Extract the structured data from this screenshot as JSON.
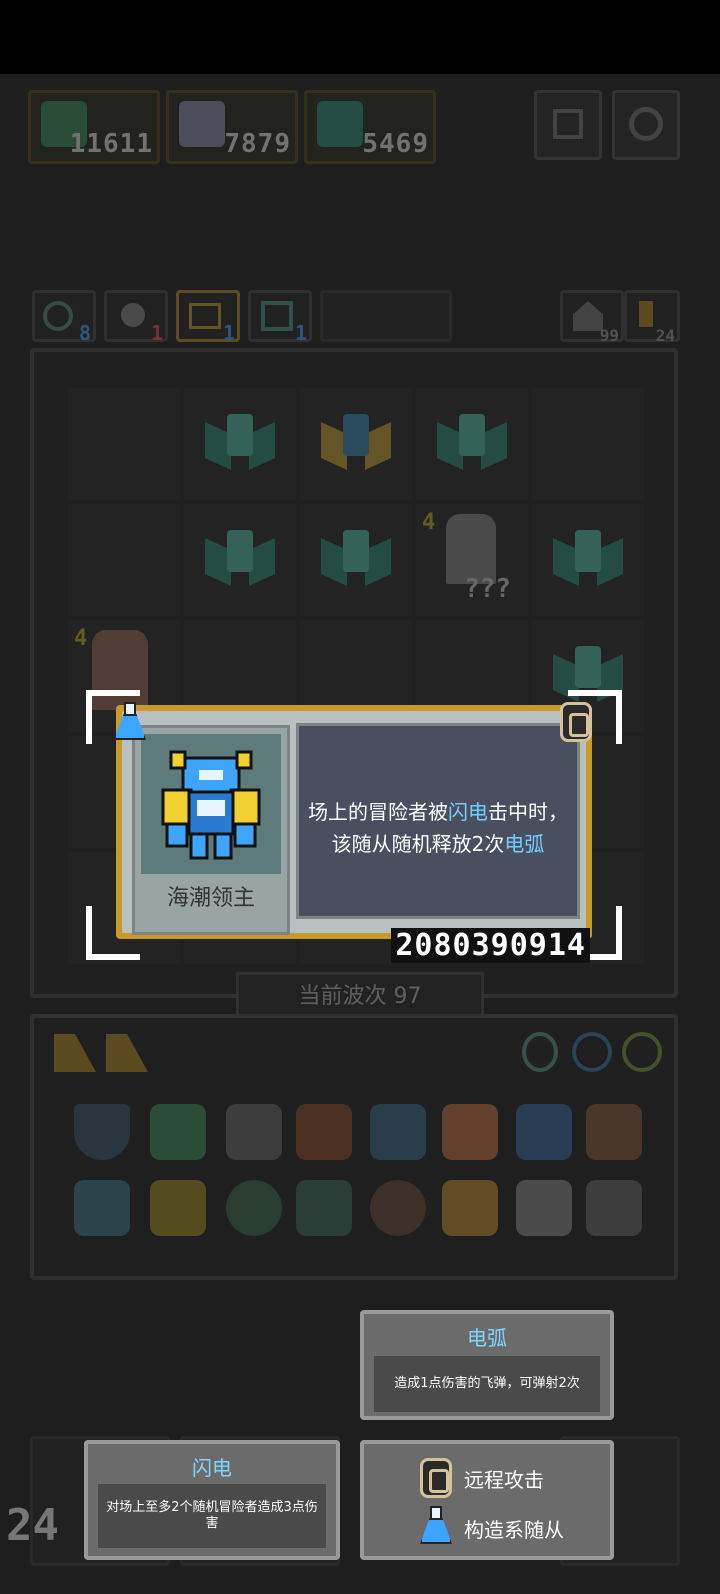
{
  "resources": [
    {
      "value": "11611",
      "icon": "tidal-green-icon",
      "color": "#3e8c5a"
    },
    {
      "value": "7879",
      "icon": "ghost-icon",
      "color": "#8a8fb0"
    },
    {
      "value": "5469",
      "icon": "tidal-minion-icon",
      "color": "#2f8c7a"
    }
  ],
  "top_buttons": [
    {
      "icon": "codex-icon"
    },
    {
      "icon": "settings-icon"
    }
  ],
  "stats": [
    {
      "icon": "eye-icon",
      "count": "8",
      "color": "#3ea5ff"
    },
    {
      "icon": "lamp-icon",
      "count": "1",
      "color": "#ff4a4a"
    },
    {
      "icon": "lightning-icon",
      "count": "1",
      "color": "#3ea5ff"
    },
    {
      "icon": "monitor-icon",
      "count": "1",
      "color": "#3ea5ff"
    }
  ],
  "counters": [
    {
      "icon": "house-icon",
      "count": "99"
    },
    {
      "icon": "key-icon",
      "count": "24"
    }
  ],
  "board": {
    "mystery_label": "???",
    "level_badge": "4"
  },
  "wave": {
    "label": "当前波次 97"
  },
  "popup": {
    "name": "海潮领主",
    "desc_part1": "场上的冒险者被",
    "desc_hl1": "闪电",
    "desc_part2": "击中时，该随从随机释放2次",
    "desc_hl2": "电弧",
    "seed": "2080390914",
    "type_icon": "flask-icon",
    "attack_icon": "gear-icon"
  },
  "cards": {
    "arc": {
      "title": "电弧",
      "body": "造成1点伤害的飞弹，可弹射2次"
    },
    "lightning": {
      "title": "闪电",
      "body": "对场上至多2个随机冒险者造成3点伤害"
    },
    "keywords": [
      {
        "icon": "gear-icon",
        "label": "远程攻击"
      },
      {
        "icon": "flask-icon",
        "label": "构造系随从"
      }
    ]
  },
  "corner_number": "24"
}
